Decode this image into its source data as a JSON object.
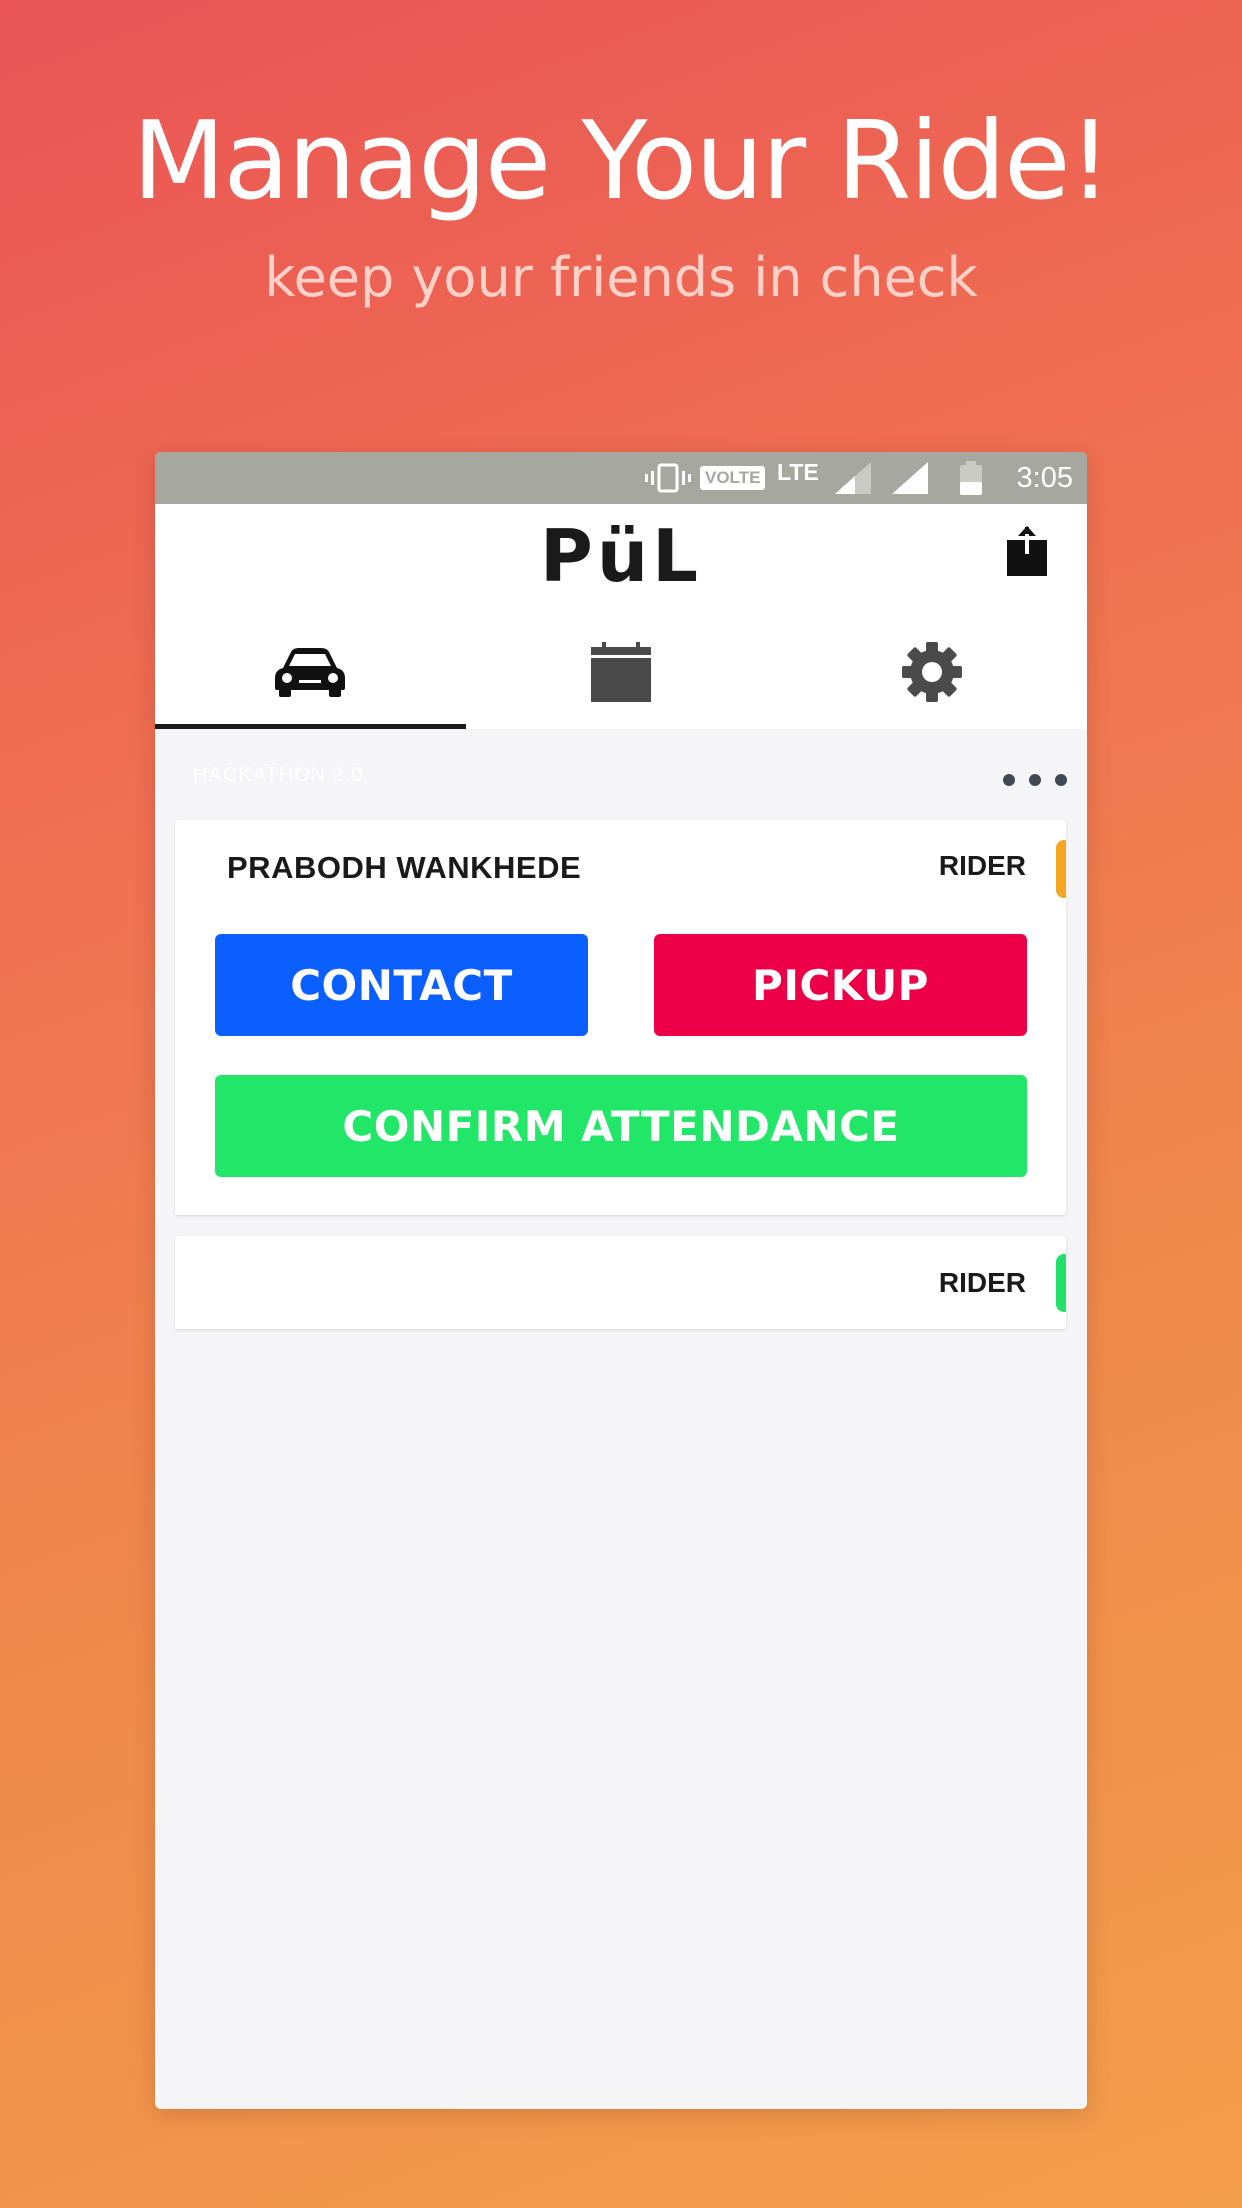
{
  "promo": {
    "headline": "Manage Your Ride!",
    "subhead": "keep your friends in check"
  },
  "status_bar": {
    "volte": "VOLTE",
    "network": "LTE",
    "time": "3:05",
    "icons": [
      "vibrate-icon",
      "signal-icon",
      "signal-icon",
      "battery-icon"
    ]
  },
  "app_header": {
    "logo": "PüL",
    "share_icon": "share-icon"
  },
  "tabs": [
    {
      "icon": "car-icon",
      "active": true
    },
    {
      "icon": "calendar-icon",
      "active": false
    },
    {
      "icon": "gear-icon",
      "active": false
    }
  ],
  "section": {
    "title": "HACKATHON 2.0",
    "menu_icon": "more-horizontal-icon"
  },
  "cards": [
    {
      "name": "PRABODH WANKHEDE",
      "role": "RIDER",
      "status_color": "#f5a623",
      "buttons": {
        "contact": "CONTACT",
        "pickup": "PICKUP",
        "confirm": "CONFIRM ATTENDANCE"
      }
    },
    {
      "name": "",
      "role": "RIDER",
      "status_color": "#22e06a"
    }
  ],
  "colors": {
    "contact": "#0b5ffe",
    "pickup": "#ec0148",
    "confirm": "#22e667",
    "gradient_top": "#ea5455",
    "gradient_bottom": "#f29f4a"
  }
}
